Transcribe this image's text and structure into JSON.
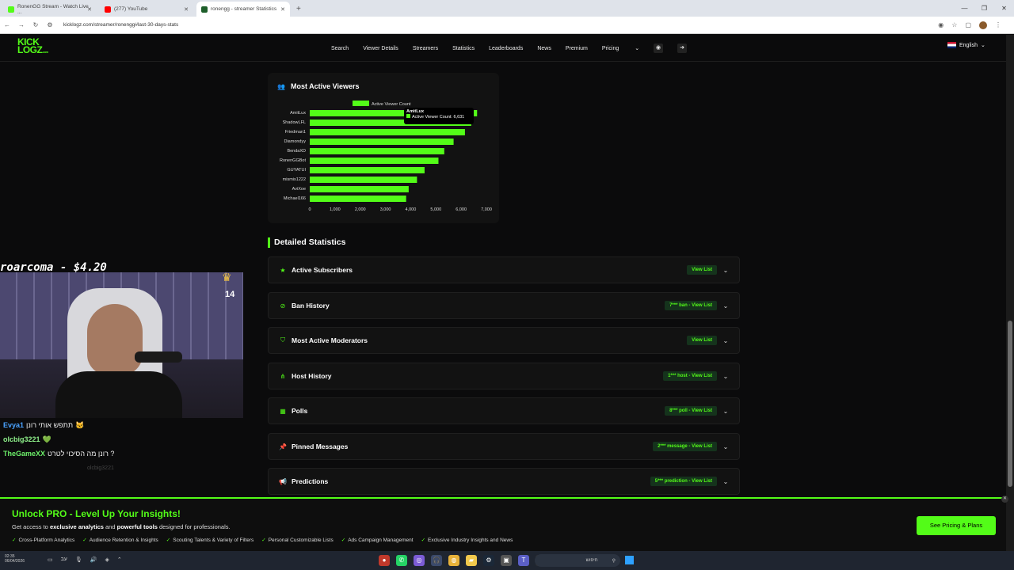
{
  "browser": {
    "tabs": [
      {
        "title": "RonenGG Stream - Watch Live ...",
        "color": "#53fc18"
      },
      {
        "title": "(277) YouTube",
        "color": "#ff0000"
      },
      {
        "title": "ronengg - streamer Statistics",
        "color": "#1e5e2a"
      }
    ],
    "url": "kicklogz.com/streamer/ronengg#last-30-days-stats"
  },
  "site": {
    "logo_top": "KICK",
    "logo_bottom": "LOGZ",
    "logo_tld": ".com",
    "nav": [
      "Search",
      "Viewer Details",
      "Streamers",
      "Statistics",
      "Leaderboards",
      "News",
      "Premium",
      "Pricing"
    ],
    "language": "English"
  },
  "chart_card": {
    "title": "Most Active Viewers",
    "tooltip_title": "AmitLux",
    "tooltip_value": "Active Viewer Count: 6,631"
  },
  "chart_data": {
    "type": "bar",
    "orientation": "horizontal",
    "categories": [
      "AmitLux",
      "ShadowLFL",
      "Friedman1",
      "Diamondyy",
      "BendaXD",
      "RonenGGBot",
      "GUYATUI",
      "mismis1222",
      "AviXoe",
      "Michael166"
    ],
    "series": [
      {
        "name": "Active Viewer Count",
        "values": [
          6631,
          6400,
          6150,
          5700,
          5330,
          5100,
          4550,
          4250,
          3920,
          3820
        ],
        "color": "#53fc18"
      }
    ],
    "xticks": [
      "0",
      "1,000",
      "2,000",
      "3,000",
      "4,000",
      "5,000",
      "6,000",
      "7,000"
    ],
    "xlim": [
      0,
      7000
    ],
    "legend_position": "top"
  },
  "detailed": {
    "title": "Detailed Statistics",
    "rows": [
      {
        "label": "Active Subscribers",
        "badge": "View List",
        "icon": "star-icon"
      },
      {
        "label": "Ban History",
        "badge": "7*** ban - View List",
        "icon": "ban-icon"
      },
      {
        "label": "Most Active Moderators",
        "badge": "View List",
        "icon": "shield-icon"
      },
      {
        "label": "Host History",
        "badge": "1*** host - View List",
        "icon": "share-icon"
      },
      {
        "label": "Polls",
        "badge": "8*** poll - View List",
        "icon": "poll-icon"
      },
      {
        "label": "Pinned Messages",
        "badge": "2*** message - View List",
        "icon": "pin-icon"
      },
      {
        "label": "Predictions",
        "badge": "5*** prediction - View List",
        "icon": "megaphone-icon"
      }
    ]
  },
  "stream": {
    "donation": "roarcoma - $4.20",
    "viewer_badge": "14",
    "chat": [
      {
        "user": "Evya1",
        "msg": "תתפש אותי רונן"
      },
      {
        "user": "olcbig3221",
        "msg": ""
      },
      {
        "user": "TheGameXX",
        "msg": "רונן מה הסיכוי לטרט ?"
      },
      {
        "user": "olcbig3221",
        "msg": ""
      }
    ]
  },
  "promo": {
    "title": "Unlock PRO - Level Up Your Insights!",
    "sub_pre": "Get access to",
    "sub_b1": "exclusive analytics",
    "sub_mid": "and",
    "sub_b2": "powerful tools",
    "sub_post": "designed for professionals.",
    "features": [
      "Cross-Platform Analytics",
      "Audience Retention & Insights",
      "Scouting Talents & Variety of Filters",
      "Personal Customizable Lists",
      "Ads Campaign Management",
      "Exclusive Industry Insights and News"
    ],
    "cta": "See Pricing & Plans"
  },
  "taskbar": {
    "time": "02:35",
    "date": "06/04/2026",
    "lang": "עב",
    "search_label": "חיפוש"
  }
}
